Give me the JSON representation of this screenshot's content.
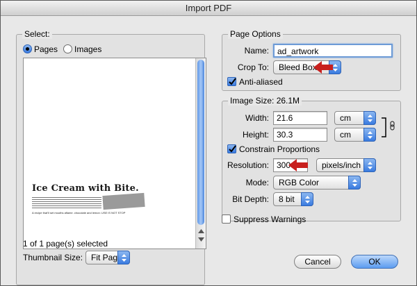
{
  "window": {
    "title": "Import PDF"
  },
  "select_group": {
    "legend": "Select:",
    "radio_pages": "Pages",
    "radio_images": "Images",
    "page_heading": "Ice Cream with Bite.",
    "page_tagline": "A recipe that'll set mouths aflame. chocolate and lemon: USE IS NOT STOP",
    "selection_status": "1 of 1 page(s) selected",
    "thumbnail_size_label": "Thumbnail Size:",
    "thumbnail_size_value": "Fit Page"
  },
  "page_options": {
    "legend": "Page Options",
    "name_label": "Name:",
    "name_value": "ad_artwork",
    "crop_to_label": "Crop To:",
    "crop_to_value": "Bleed Box",
    "anti_aliased_label": "Anti-aliased"
  },
  "image_size": {
    "legend": "Image Size: 26.1M",
    "width_label": "Width:",
    "width_value": "21.6",
    "width_unit": "cm",
    "height_label": "Height:",
    "height_value": "30.3",
    "height_unit": "cm",
    "constrain_label": "Constrain Proportions",
    "resolution_label": "Resolution:",
    "resolution_value": "300",
    "resolution_unit": "pixels/inch",
    "mode_label": "Mode:",
    "mode_value": "RGB Color",
    "bit_depth_label": "Bit Depth:",
    "bit_depth_value": "8 bit"
  },
  "suppress_warnings_label": "Suppress Warnings",
  "buttons": {
    "cancel": "Cancel",
    "ok": "OK"
  },
  "colors": {
    "accent": "#3a7be0",
    "annotation_arrow": "#c8201e"
  }
}
